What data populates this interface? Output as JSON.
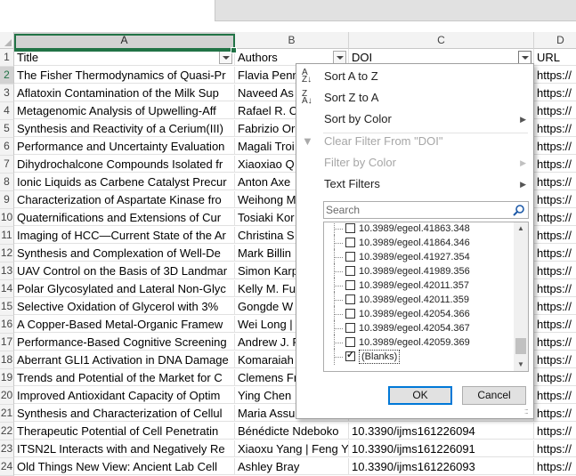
{
  "columns": [
    {
      "letter": "A",
      "header": "Title"
    },
    {
      "letter": "B",
      "header": "Authors"
    },
    {
      "letter": "C",
      "header": "DOI"
    },
    {
      "letter": "D",
      "header": "URL"
    }
  ],
  "header_row": "1",
  "rows": [
    {
      "n": "2",
      "a": "The Fisher Thermodynamics of Quasi-Pr",
      "b": "Flavia Penn",
      "c": "",
      "d": "https://"
    },
    {
      "n": "3",
      "a": "Aflatoxin Contamination of the Milk Sup",
      "b": "Naveed As",
      "c": "",
      "d": "https://"
    },
    {
      "n": "4",
      "a": "Metagenomic Analysis of Upwelling-Aff",
      "b": "Rafael R. C",
      "c": "",
      "d": "https://"
    },
    {
      "n": "5",
      "a": "Synthesis and Reactivity of a Cerium(III)",
      "b": "Fabrizio Or",
      "c": "",
      "d": "https://"
    },
    {
      "n": "6",
      "a": "Performance and Uncertainty Evaluation",
      "b": "Magali Troi",
      "c": "",
      "d": "https://"
    },
    {
      "n": "7",
      "a": "Dihydrochalcone Compounds Isolated fr",
      "b": "Xiaoxiao Q",
      "c": "",
      "d": "https://"
    },
    {
      "n": "8",
      "a": "Ionic Liquids as Carbene Catalyst Precur",
      "b": "Anton Axe",
      "c": "",
      "d": "https://"
    },
    {
      "n": "9",
      "a": "Characterization of Aspartate Kinase fro",
      "b": "Weihong M",
      "c": "",
      "d": "https://"
    },
    {
      "n": "10",
      "a": "Quaternifications and Extensions of Cur",
      "b": "Tosiaki Kor",
      "c": "",
      "d": "https://"
    },
    {
      "n": "11",
      "a": "Imaging of HCC—Current State of the Ar",
      "b": "Christina S",
      "c": "",
      "d": "https://"
    },
    {
      "n": "12",
      "a": "Synthesis and Complexation of Well-De",
      "b": "Mark Billin",
      "c": "",
      "d": "https://"
    },
    {
      "n": "13",
      "a": "UAV Control on the Basis of 3D Landmar",
      "b": "Simon Karp",
      "c": "",
      "d": "https://"
    },
    {
      "n": "14",
      "a": "Polar Glycosylated and Lateral Non-Glyc",
      "b": "Kelly M. Fu",
      "c": "",
      "d": "https://"
    },
    {
      "n": "15",
      "a": "Selective Oxidation of Glycerol with 3%",
      "b": "Gongde W",
      "c": "",
      "d": "https://"
    },
    {
      "n": "16",
      "a": "A Copper-Based Metal-Organic Framew",
      "b": "Wei Long | Y",
      "c": "",
      "d": "https://"
    },
    {
      "n": "17",
      "a": "Performance-Based Cognitive Screening",
      "b": "Andrew J. F",
      "c": "",
      "d": "https://"
    },
    {
      "n": "18",
      "a": "Aberrant GLI1 Activation in DNA Damage",
      "b": "Komaraiah",
      "c": "",
      "d": "https://"
    },
    {
      "n": "19",
      "a": "Trends and Potential of the Market for C",
      "b": "Clemens Fr",
      "c": "",
      "d": "https://"
    },
    {
      "n": "20",
      "a": "Improved Antioxidant Capacity of Optim",
      "b": "Ying Chen |",
      "c": "",
      "d": "https://"
    },
    {
      "n": "21",
      "a": "Synthesis and Characterization of Cellul",
      "b": "Maria Assu",
      "c": "",
      "d": "https://"
    },
    {
      "n": "22",
      "a": "Therapeutic Potential of Cell Penetratin",
      "b": "Bénédicte Ndeboko",
      "c": "10.3390/ijms161226094",
      "d": "https://"
    },
    {
      "n": "23",
      "a": "ITSN2L Interacts with and Negatively Re",
      "b": "Xiaoxu Yang | Feng Ya",
      "c": "10.3390/ijms161226091",
      "d": "https://"
    },
    {
      "n": "24",
      "a": "Old Things New View: Ancient Lab Cell",
      "b": "Ashley Bray",
      "c": "10.3390/ijms161226093",
      "d": "https://"
    }
  ],
  "filter_menu": {
    "sort_az": "Sort A to Z",
    "sort_za": "Sort Z to A",
    "sort_color": "Sort by Color",
    "clear_filter": "Clear Filter From \"DOI\"",
    "filter_color": "Filter by Color",
    "text_filters": "Text Filters",
    "search_placeholder": "Search",
    "items": [
      {
        "label": "10.3989/egeol.41863.348",
        "checked": false
      },
      {
        "label": "10.3989/egeol.41864.346",
        "checked": false
      },
      {
        "label": "10.3989/egeol.41927.354",
        "checked": false
      },
      {
        "label": "10.3989/egeol.41989.356",
        "checked": false
      },
      {
        "label": "10.3989/egeol.42011.357",
        "checked": false
      },
      {
        "label": "10.3989/egeol.42011.359",
        "checked": false
      },
      {
        "label": "10.3989/egeol.42054.366",
        "checked": false
      },
      {
        "label": "10.3989/egeol.42054.367",
        "checked": false
      },
      {
        "label": "10.3989/egeol.42059.369",
        "checked": false
      },
      {
        "label": "(Blanks)",
        "checked": true
      }
    ],
    "ok": "OK",
    "cancel": "Cancel"
  },
  "colors": {
    "accent": "#217346",
    "button_focus": "#0078d7"
  }
}
